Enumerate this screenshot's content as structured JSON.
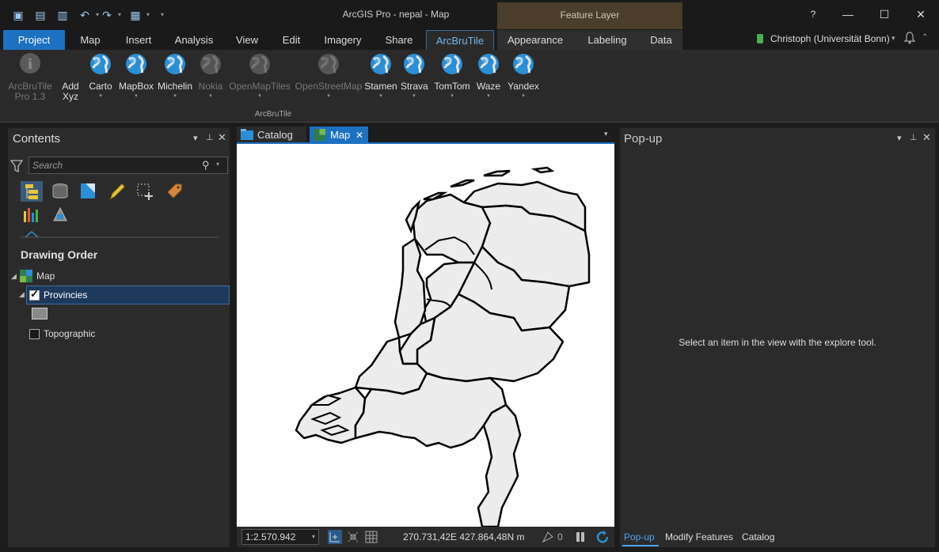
{
  "window": {
    "title": "ArcGIS Pro - nepal - Map",
    "context_header": "Feature Layer",
    "help": "?",
    "minimize": "—",
    "maximize": "☐",
    "close": "✕"
  },
  "ribbon_tabs": [
    "Project",
    "Map",
    "Insert",
    "Analysis",
    "View",
    "Edit",
    "Imagery",
    "Share",
    "ArcBruTile",
    "Appearance",
    "Labeling",
    "Data"
  ],
  "active_tab": "ArcBruTile",
  "user": {
    "name": "Christoph (Universität Bonn)",
    "dropdown": "▾"
  },
  "ribbon": {
    "group_label": "ArcBruTile",
    "about": {
      "line1": "ArcBruTile",
      "line2": "Pro 1.3"
    },
    "add_xyz": {
      "line1": "Add",
      "line2": "Xyz"
    },
    "providers": [
      {
        "label": "Carto",
        "enabled": true
      },
      {
        "label": "MapBox",
        "enabled": true
      },
      {
        "label": "Michelin",
        "enabled": true
      },
      {
        "label": "Nokia",
        "enabled": false
      },
      {
        "label": "OpenMapTiles",
        "enabled": false
      },
      {
        "label": "OpenStreetMap",
        "enabled": false
      },
      {
        "label": "Stamen",
        "enabled": true
      },
      {
        "label": "Strava",
        "enabled": true
      },
      {
        "label": "TomTom",
        "enabled": true
      },
      {
        "label": "Waze",
        "enabled": true
      },
      {
        "label": "Yandex",
        "enabled": true
      }
    ]
  },
  "contents": {
    "title": "Contents",
    "search_placeholder": "Search",
    "drawing_order": "Drawing Order",
    "map_item": "Map",
    "layers": [
      {
        "name": "Provincies",
        "checked": true
      },
      {
        "name": "Topographic",
        "checked": false
      }
    ]
  },
  "view_tabs": {
    "catalog": "Catalog",
    "map": "Map",
    "close": "✕"
  },
  "status": {
    "scale": "1:2.570.942",
    "coordinates": "270.731,42E 427.864,48N m",
    "selected_count": "0"
  },
  "popup": {
    "title": "Pop-up",
    "message": "Select an item in the view with the explore tool."
  },
  "bottom_tabs": [
    "Pop-up",
    "Modify Features",
    "Catalog"
  ],
  "colors": {
    "accent": "#1c71c2",
    "land_fill": "#ececec",
    "outline": "#000000"
  }
}
